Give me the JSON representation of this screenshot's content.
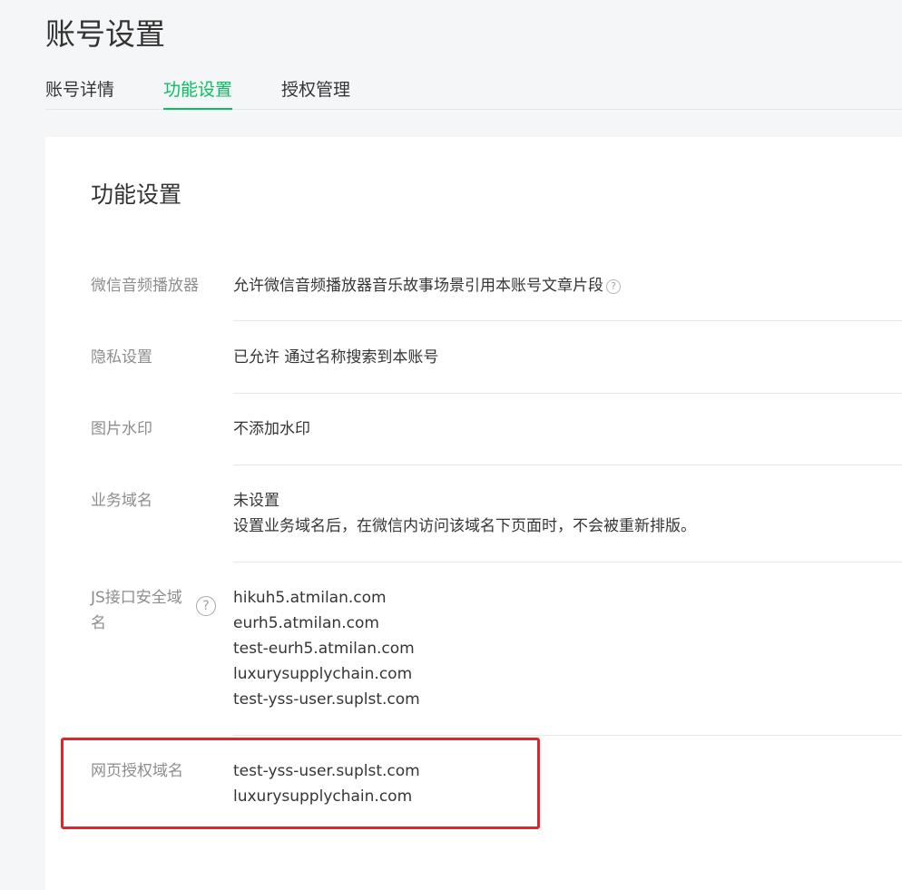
{
  "page": {
    "title": "账号设置"
  },
  "tabs": [
    {
      "label": "账号详情",
      "active": false
    },
    {
      "label": "功能设置",
      "active": true
    },
    {
      "label": "授权管理",
      "active": false
    }
  ],
  "section": {
    "title": "功能设置",
    "rows": {
      "audio_player": {
        "label": "微信音频播放器",
        "lines": [
          "允许微信音频播放器音乐故事场景引用本账号文章片段"
        ]
      },
      "privacy": {
        "label": "隐私设置",
        "lines": [
          "已允许 通过名称搜索到本账号"
        ]
      },
      "watermark": {
        "label": "图片水印",
        "lines": [
          "不添加水印"
        ]
      },
      "business_domain": {
        "label": "业务域名",
        "lines": [
          "未设置",
          "设置业务域名后，在微信内访问该域名下页面时，不会被重新排版。"
        ]
      },
      "js_domain": {
        "label": "JS接口安全域名",
        "lines": [
          "hikuh5.atmilan.com",
          "eurh5.atmilan.com",
          "test-eurh5.atmilan.com",
          "luxurysupplychain.com",
          "test-yss-user.suplst.com"
        ]
      },
      "oauth_domain": {
        "label": "网页授权域名",
        "lines": [
          "test-yss-user.suplst.com",
          "luxurysupplychain.com"
        ]
      }
    }
  },
  "icons": {
    "help": "question-circle-icon",
    "help_glyph": "?"
  },
  "colors": {
    "accent": "#07c160",
    "highlight": "#e0242a",
    "label": "#8d8d8d",
    "text": "#353535",
    "background": "#f5f6f7"
  }
}
